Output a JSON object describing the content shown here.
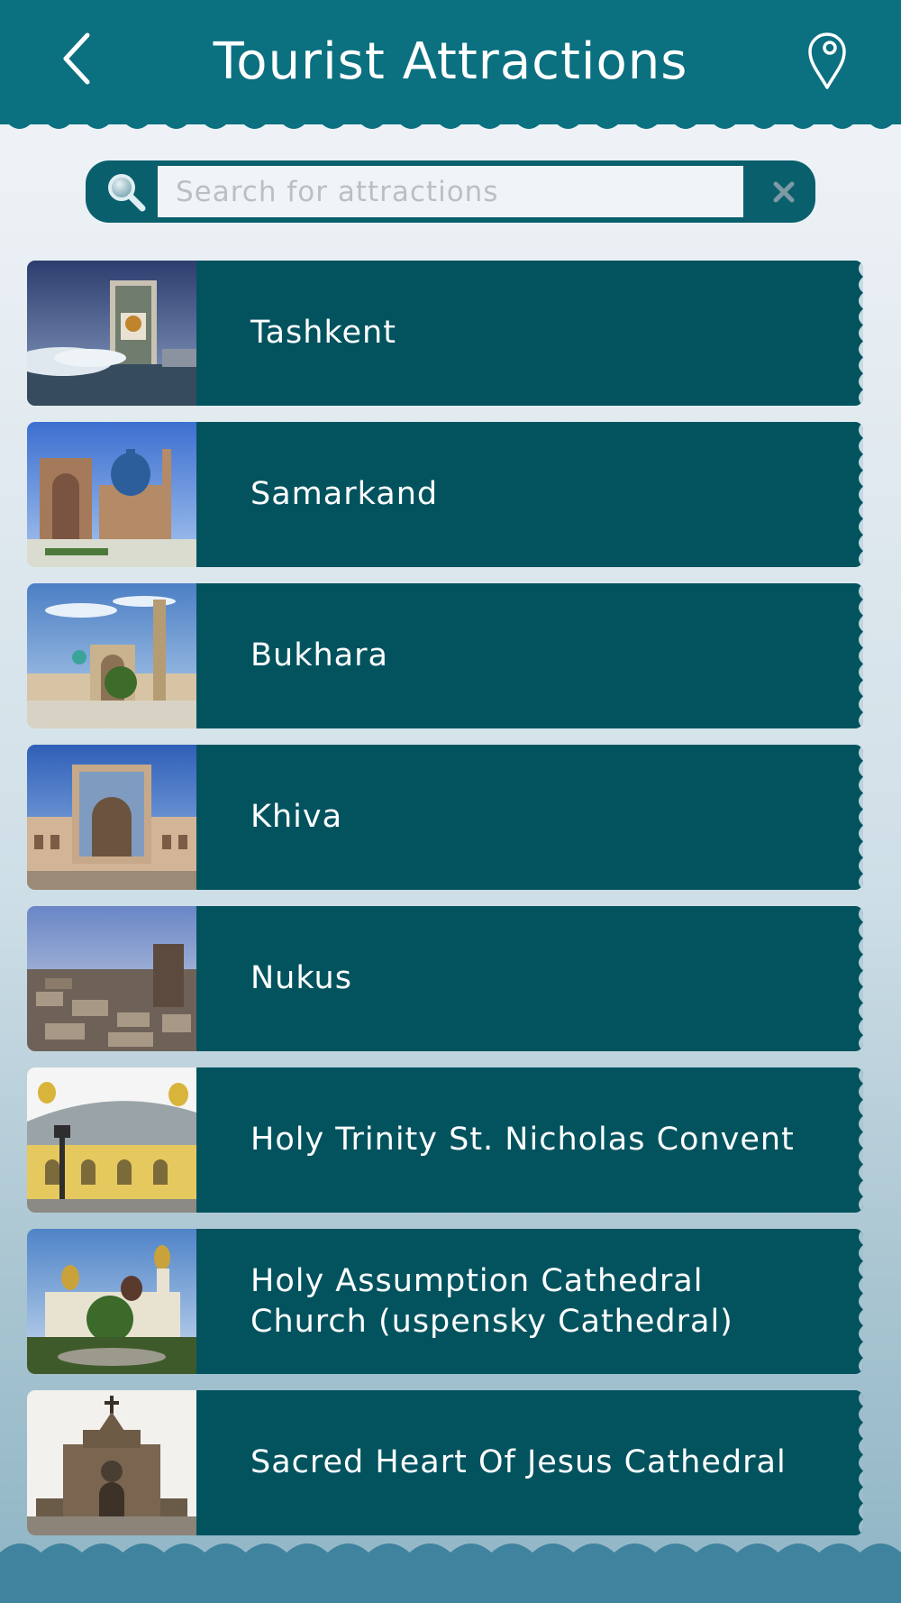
{
  "header": {
    "title": "Tourist Attractions",
    "back_icon": "chevron-left-icon",
    "location_icon": "map-pin-icon"
  },
  "search": {
    "placeholder": "Search for attractions",
    "value": "",
    "search_icon": "magnifier-icon",
    "clear_icon": "close-icon"
  },
  "colors": {
    "header": "#0b7080",
    "item_panel": "#03535f",
    "search_bar": "#0a5f6d",
    "footer": "#3f839f"
  },
  "attractions": [
    {
      "label": "Tashkent"
    },
    {
      "label": "Samarkand"
    },
    {
      "label": "Bukhara"
    },
    {
      "label": "Khiva"
    },
    {
      "label": "Nukus"
    },
    {
      "label": "Holy Trinity St. Nicholas Convent"
    },
    {
      "label": "Holy Assumption Cathedral Church (uspensky Cathedral)"
    },
    {
      "label": "Sacred Heart Of Jesus Cathedral"
    }
  ]
}
